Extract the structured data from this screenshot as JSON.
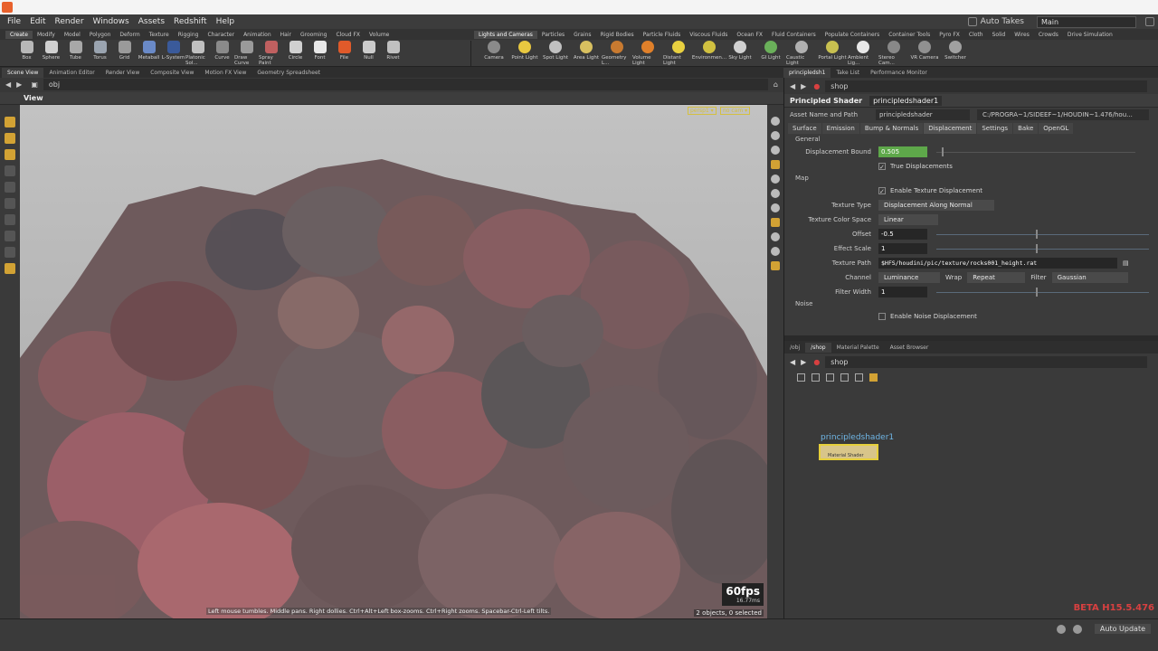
{
  "menubar": {
    "items": [
      "File",
      "Edit",
      "Render",
      "Windows",
      "Assets",
      "Redshift",
      "Help"
    ],
    "auto_takes": "Auto Takes",
    "desktop": "Main"
  },
  "shelf": {
    "left_tabs": [
      "Create",
      "Modify",
      "Model",
      "Polygon",
      "Deform",
      "Texture",
      "Rigging",
      "Character",
      "Animation",
      "Hair",
      "Grooming",
      "Cloud FX",
      "Volume"
    ],
    "right_tabs": [
      "Lights and Cameras",
      "Particles",
      "Grains",
      "Rigid Bodies",
      "Particle Fluids",
      "Viscous Fluids",
      "Ocean FX",
      "Fluid Containers",
      "Populate Containers",
      "Container Tools",
      "Pyro FX",
      "Cloth",
      "Solid",
      "Wires",
      "Crowds",
      "Drive Simulation"
    ],
    "left_tools": [
      "Box",
      "Sphere",
      "Tube",
      "Torus",
      "Grid",
      "Metaball",
      "L-System",
      "Platonic Sol...",
      "Curve",
      "Draw Curve",
      "Spray Paint",
      "Circle",
      "Font",
      "File",
      "Null",
      "Rivet"
    ],
    "right_tools": [
      "Camera",
      "Point Light",
      "Spot Light",
      "Area Light",
      "Geometry L...",
      "Volume Light",
      "Distant Light",
      "Environmen...",
      "Sky Light",
      "GI Light",
      "Caustic Light",
      "Portal Light",
      "Ambient Lig...",
      "Stereo Cam...",
      "VR Camera",
      "Switcher"
    ],
    "left_colors": [
      "#b8b8b8",
      "#d0d0d0",
      "#a8a8a8",
      "#9aa4b0",
      "#9a9a9a",
      "#6a8ac8",
      "#3a5a9a",
      "#c0c0c0",
      "#8a8a8a",
      "#9a9a9a",
      "#c06060",
      "#d0d0d0",
      "#e8e8e8",
      "#e05a2a",
      "#cccccc",
      "#c0c0c0"
    ],
    "right_colors": [
      "#8a8a8a",
      "#e8c840",
      "#c0c0c0",
      "#d8c060",
      "#c87a30",
      "#e0802a",
      "#e8d040",
      "#d0c040",
      "#d0d0d0",
      "#6ab05a",
      "#b0b0b0",
      "#c8c050",
      "#e8e8e8",
      "#888888",
      "#909090",
      "#a0a0a0"
    ]
  },
  "panels": {
    "left_tabs": [
      "Scene View",
      "Animation Editor",
      "Render View",
      "Composite View",
      "Motion FX View",
      "Geometry Spreadsheet"
    ],
    "right_tabs": [
      "principledsh1",
      "Take List",
      "Performance Monitor"
    ]
  },
  "viewport": {
    "path": "obj",
    "title": "View",
    "persp": "persp1 ▾",
    "cam": "no cam ▾",
    "fps": "60fps",
    "ms": "16.77ms",
    "hint": "Left mouse tumbles. Middle pans. Right dollies. Ctrl+Alt+Left box-zooms. Ctrl+Right zooms. Spacebar-Ctrl-Left tilts.",
    "objects": "2 objects, 0 selected"
  },
  "params": {
    "path": "shop",
    "node_type": "Principled Shader",
    "node_name": "principledshader1",
    "asset_label": "Asset Name and Path",
    "asset_name": "principledshader",
    "asset_path": "C:/PROGRA~1/SIDEEF~1/HOUDIN~1.476/hou...",
    "tabs": [
      "Surface",
      "Emission",
      "Bump & Normals",
      "Displacement",
      "Settings",
      "Bake",
      "OpenGL"
    ],
    "general": "General",
    "disp_bound_label": "Displacement Bound",
    "disp_bound_value": "0.505",
    "true_disp": "True Displacements",
    "map": "Map",
    "enable_tex_disp": "Enable Texture Displacement",
    "tex_type_label": "Texture Type",
    "tex_type_value": "Displacement Along Normal",
    "tex_cs_label": "Texture Color Space",
    "tex_cs_value": "Linear",
    "offset_label": "Offset",
    "offset_value": "-0.5",
    "effect_label": "Effect Scale",
    "effect_value": "1",
    "tex_path_label": "Texture Path",
    "tex_path_value": "$HFS/houdini/pic/texture/rocks001_height.rat",
    "channel_label": "Channel",
    "channel_value": "Luminance",
    "wrap_label": "Wrap",
    "wrap_value": "Repeat",
    "filter_label": "Filter",
    "filter_value": "Gaussian",
    "fwidth_label": "Filter Width",
    "fwidth_value": "1",
    "noise": "Noise",
    "enable_noise": "Enable Noise Displacement"
  },
  "network": {
    "tabs": [
      "/obj",
      "/shop",
      "Material Palette",
      "Asset Browser"
    ],
    "path": "shop",
    "node_name": "principledshader1",
    "node_type": "Material Shader",
    "beta": "BETA H15.5.476"
  },
  "status": {
    "update": "Auto Update"
  }
}
